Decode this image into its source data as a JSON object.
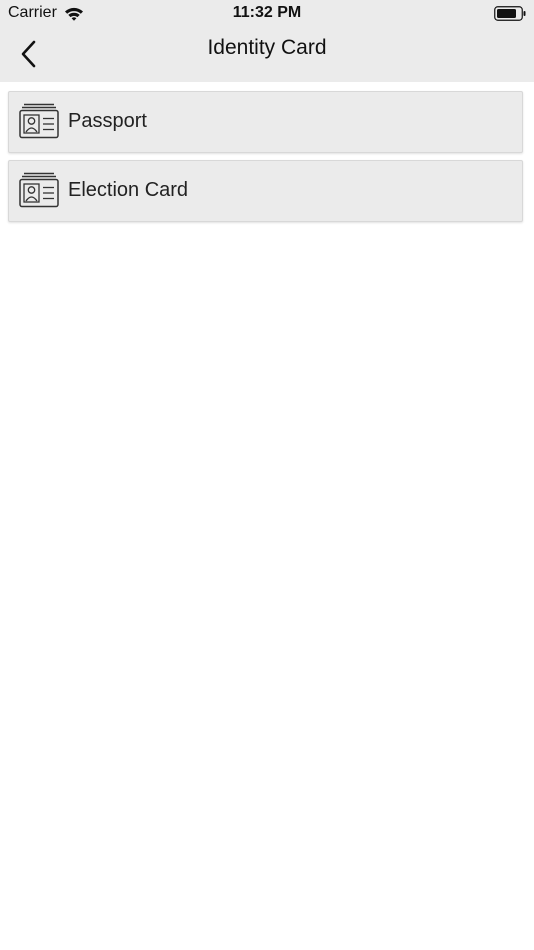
{
  "status_bar": {
    "carrier": "Carrier",
    "time": "11:32 PM",
    "wifi_icon": "wifi-icon",
    "battery_icon": "battery-icon"
  },
  "nav": {
    "title": "Identity Card",
    "back_icon": "chevron-left-icon"
  },
  "items": [
    {
      "label": "Passport",
      "icon": "id-card-icon"
    },
    {
      "label": "Election Card",
      "icon": "id-card-icon"
    }
  ],
  "colors": {
    "header_bg": "#ebebeb",
    "item_bg": "#ebebeb",
    "text": "#1a1a1a",
    "page_bg": "#ffffff"
  }
}
